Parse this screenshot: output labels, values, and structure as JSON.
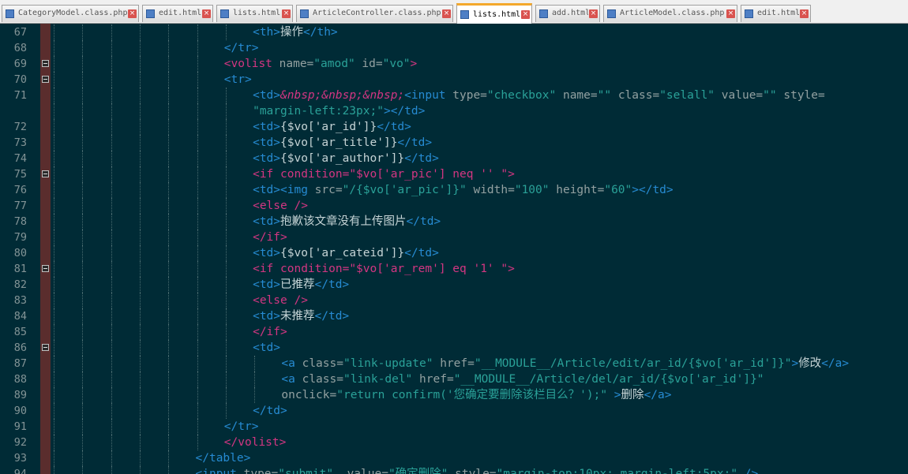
{
  "tabs": [
    {
      "label": "CategoryModel.class.php",
      "active": false
    },
    {
      "label": "edit.html",
      "active": false
    },
    {
      "label": "lists.html",
      "active": false
    },
    {
      "label": "ArticleController.class.php",
      "active": false
    },
    {
      "label": "lists.html",
      "active": true
    },
    {
      "label": "add.html",
      "active": false
    },
    {
      "label": "ArticleModel.class.php",
      "active": false
    },
    {
      "label": "edit.html",
      "active": false
    }
  ],
  "tab_close_glyph": "×",
  "editor": {
    "colors": {
      "background": "#002b36",
      "tag": "#268bd2",
      "directive": "#d33682",
      "attribute": "#93a1a1",
      "string": "#2aa198",
      "text": "#c5d3d5",
      "line_number": "#839496",
      "fold_bar": "#5a2d2d"
    },
    "lines": [
      {
        "n": "67",
        "indent": 7,
        "fold": false,
        "tokens": [
          [
            "t",
            "<th>"
          ],
          [
            "x",
            "操作"
          ],
          [
            "t",
            "</th>"
          ]
        ]
      },
      {
        "n": "68",
        "indent": 6,
        "fold": false,
        "tokens": [
          [
            "t",
            "</tr>"
          ]
        ]
      },
      {
        "n": "69",
        "indent": 6,
        "fold": true,
        "tokens": [
          [
            "d",
            "<volist "
          ],
          [
            "a",
            "name="
          ],
          [
            "s",
            "\"amod\""
          ],
          [
            "a",
            " id="
          ],
          [
            "s",
            "\"vo\""
          ],
          [
            "d",
            ">"
          ]
        ]
      },
      {
        "n": "70",
        "indent": 6,
        "fold": true,
        "tokens": [
          [
            "t",
            "<tr>"
          ]
        ]
      },
      {
        "n": "71",
        "indent": 7,
        "fold": false,
        "tokens": [
          [
            "t",
            "<td>"
          ],
          [
            "e",
            "&nbsp;&nbsp;&nbsp;"
          ],
          [
            "t",
            "<input "
          ],
          [
            "a",
            "type="
          ],
          [
            "s",
            "\"checkbox\""
          ],
          [
            "a",
            " name="
          ],
          [
            "s",
            "\"\""
          ],
          [
            "a",
            " class="
          ],
          [
            "s",
            "\"selall\""
          ],
          [
            "a",
            " value="
          ],
          [
            "s",
            "\"\""
          ],
          [
            "a",
            " style="
          ]
        ]
      },
      {
        "n": "",
        "indent": 7,
        "fold": false,
        "tokens": [
          [
            "s",
            "\"margin-left:23px;\""
          ],
          [
            "t",
            "></td>"
          ]
        ]
      },
      {
        "n": "72",
        "indent": 7,
        "fold": false,
        "tokens": [
          [
            "t",
            "<td>"
          ],
          [
            "x",
            "{$vo['ar_id']}"
          ],
          [
            "t",
            "</td>"
          ]
        ]
      },
      {
        "n": "73",
        "indent": 7,
        "fold": false,
        "tokens": [
          [
            "t",
            "<td>"
          ],
          [
            "x",
            "{$vo['ar_title']}"
          ],
          [
            "t",
            "</td>"
          ]
        ]
      },
      {
        "n": "74",
        "indent": 7,
        "fold": false,
        "tokens": [
          [
            "t",
            "<td>"
          ],
          [
            "x",
            "{$vo['ar_author']}"
          ],
          [
            "t",
            "</td>"
          ]
        ]
      },
      {
        "n": "75",
        "indent": 7,
        "fold": true,
        "tokens": [
          [
            "d",
            "<if "
          ],
          [
            "d",
            "condition="
          ],
          [
            "d",
            "\"$vo['ar_pic'] neq '' \""
          ],
          [
            "d",
            ">"
          ]
        ]
      },
      {
        "n": "76",
        "indent": 7,
        "fold": false,
        "tokens": [
          [
            "t",
            "<td><img "
          ],
          [
            "a",
            "src="
          ],
          [
            "s",
            "\"/{$vo['ar_pic']}\""
          ],
          [
            "a",
            " width="
          ],
          [
            "s",
            "\"100\""
          ],
          [
            "a",
            " height="
          ],
          [
            "s",
            "\"60\""
          ],
          [
            "t",
            "></td>"
          ]
        ]
      },
      {
        "n": "77",
        "indent": 7,
        "fold": false,
        "tokens": [
          [
            "d",
            "<else />"
          ]
        ]
      },
      {
        "n": "78",
        "indent": 7,
        "fold": false,
        "tokens": [
          [
            "t",
            "<td>"
          ],
          [
            "x",
            "抱歉该文章没有上传图片"
          ],
          [
            "t",
            "</td>"
          ]
        ]
      },
      {
        "n": "79",
        "indent": 7,
        "fold": false,
        "tokens": [
          [
            "d",
            "</if>"
          ]
        ]
      },
      {
        "n": "80",
        "indent": 7,
        "fold": false,
        "tokens": [
          [
            "t",
            "<td>"
          ],
          [
            "x",
            "{$vo['ar_cateid']}"
          ],
          [
            "t",
            "</td>"
          ]
        ]
      },
      {
        "n": "81",
        "indent": 7,
        "fold": true,
        "tokens": [
          [
            "d",
            "<if "
          ],
          [
            "d",
            "condition="
          ],
          [
            "d",
            "\"$vo['ar_rem'] eq '1' \""
          ],
          [
            "d",
            ">"
          ]
        ]
      },
      {
        "n": "82",
        "indent": 7,
        "fold": false,
        "tokens": [
          [
            "t",
            "<td>"
          ],
          [
            "x",
            "已推荐"
          ],
          [
            "t",
            "</td>"
          ]
        ]
      },
      {
        "n": "83",
        "indent": 7,
        "fold": false,
        "tokens": [
          [
            "d",
            "<else />"
          ]
        ]
      },
      {
        "n": "84",
        "indent": 7,
        "fold": false,
        "tokens": [
          [
            "t",
            "<td>"
          ],
          [
            "x",
            "未推荐"
          ],
          [
            "t",
            "</td>"
          ]
        ]
      },
      {
        "n": "85",
        "indent": 7,
        "fold": false,
        "tokens": [
          [
            "d",
            "</if>"
          ]
        ]
      },
      {
        "n": "86",
        "indent": 7,
        "fold": true,
        "tokens": [
          [
            "t",
            "<td>"
          ]
        ]
      },
      {
        "n": "87",
        "indent": 8,
        "fold": false,
        "tokens": [
          [
            "t",
            "<a "
          ],
          [
            "a",
            "class="
          ],
          [
            "s",
            "\"link-update\""
          ],
          [
            "a",
            " href="
          ],
          [
            "s",
            "\"__MODULE__/Article/edit/ar_id/{$vo['ar_id']}\""
          ],
          [
            "t",
            ">"
          ],
          [
            "x",
            "修改"
          ],
          [
            "t",
            "</a>"
          ]
        ]
      },
      {
        "n": "88",
        "indent": 8,
        "fold": false,
        "tokens": [
          [
            "t",
            "<a "
          ],
          [
            "a",
            "class="
          ],
          [
            "s",
            "\"link-del\""
          ],
          [
            "a",
            " href="
          ],
          [
            "s",
            "\"__MODULE__/Article/del/ar_id/{$vo['ar_id']}\""
          ]
        ]
      },
      {
        "n": "89",
        "indent": 8,
        "fold": false,
        "tokens": [
          [
            "a",
            "onclick="
          ],
          [
            "s",
            "\"return confirm('您确定要删除该栏目么？');\""
          ],
          [
            "t",
            " >"
          ],
          [
            "x",
            "删除"
          ],
          [
            "t",
            "</a>"
          ]
        ]
      },
      {
        "n": "90",
        "indent": 7,
        "fold": false,
        "tokens": [
          [
            "t",
            "</td>"
          ]
        ]
      },
      {
        "n": "91",
        "indent": 6,
        "fold": false,
        "tokens": [
          [
            "t",
            "</tr>"
          ]
        ]
      },
      {
        "n": "92",
        "indent": 6,
        "fold": false,
        "tokens": [
          [
            "d",
            "</volist>"
          ]
        ]
      },
      {
        "n": "93",
        "indent": 5,
        "fold": false,
        "tokens": [
          [
            "t",
            "</table>"
          ]
        ]
      },
      {
        "n": "94",
        "indent": 5,
        "fold": false,
        "tokens": [
          [
            "t",
            "<input "
          ],
          [
            "a",
            "type="
          ],
          [
            "s",
            "\"submit\""
          ],
          [
            "a",
            "  value="
          ],
          [
            "s",
            "\"确定删除\""
          ],
          [
            "a",
            " style="
          ],
          [
            "s",
            "\"margin-top:10px; margin-left:5px;\""
          ],
          [
            "t",
            " />"
          ]
        ]
      }
    ]
  }
}
